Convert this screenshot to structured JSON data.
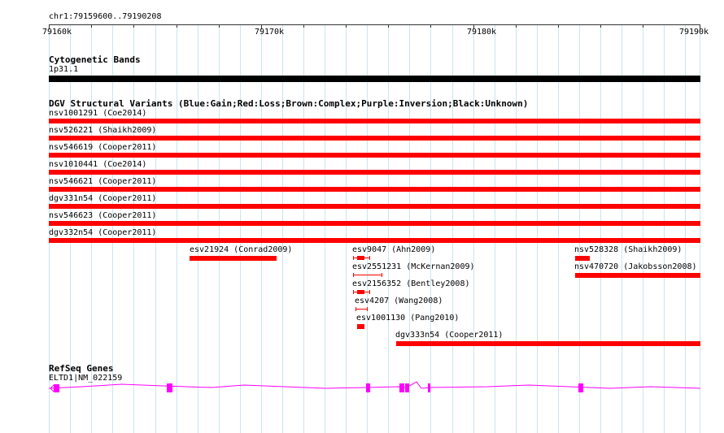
{
  "coordinates": "chr1:79159600..79190208",
  "ruler": {
    "ticks": [
      "79160k",
      "79170k",
      "79180k",
      "79190k"
    ]
  },
  "cytoband": {
    "title": "Cytogenetic Bands",
    "band": "1p31.1"
  },
  "dgv": {
    "title": "DGV Structural Variants (Blue:Gain;Red:Loss;Brown:Complex;Purple:Inversion;Black:Unknown)",
    "full_rows": [
      "nsv1001291 (Coe2014)",
      "nsv526221 (Shaikh2009)",
      "nsv546619 (Cooper2011)",
      "nsv1010441 (Coe2014)",
      "nsv546621 (Cooper2011)",
      "dgv331n54 (Cooper2011)",
      "nsv546623 (Cooper2011)",
      "dgv332n54 (Cooper2011)"
    ],
    "short": [
      "esv21924 (Conrad2009)",
      "esv9047 (Ahn2009)",
      "nsv528328 (Shaikh2009)",
      "esv2551231 (McKernan2009)",
      "nsv470720 (Jakobsson2008)",
      "esv2156352 (Bentley2008)",
      "esv4207 (Wang2008)",
      "esv1001130 (Pang2010)",
      "dgv333n54 (Cooper2011)"
    ],
    "loss_color": "#ff0000"
  },
  "refseq": {
    "title": "RefSeq Genes",
    "gene": "ELTD1|NM_022159",
    "color": "#ff00ff"
  }
}
